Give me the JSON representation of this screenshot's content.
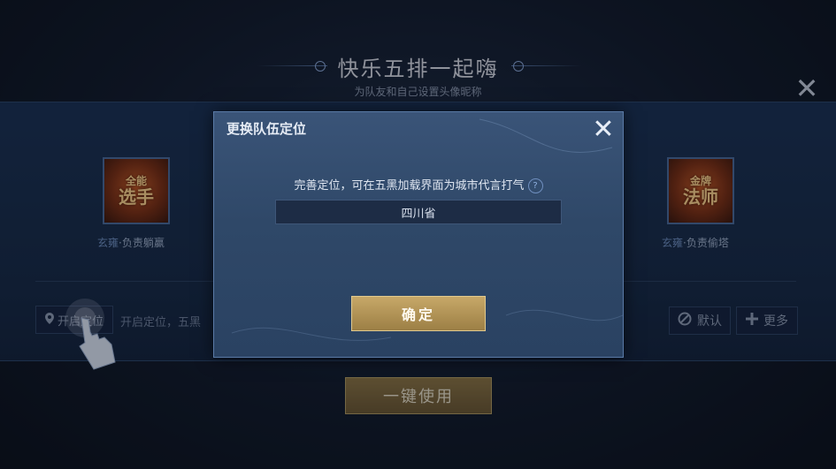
{
  "header": {
    "title": "快乐五排一起嗨",
    "subtitle": "为队友和自己设置头像昵称",
    "close_icon": "close-icon"
  },
  "roles": [
    {
      "badge_top": "全能",
      "badge_bottom": "选手",
      "name_prefix": "玄雍",
      "name_rest": "·负责躺赢"
    },
    {
      "badge_top": "金牌",
      "badge_bottom": "法师",
      "name_prefix": "玄雍",
      "name_rest": "·负责偷塔"
    }
  ],
  "location": {
    "button_label": "开启定位",
    "hint": "开启定位，五黑",
    "pin_icon": "location-pin-icon"
  },
  "side_buttons": {
    "default_label": "默认",
    "more_label": "更多"
  },
  "use_button": {
    "label": "一键使用"
  },
  "modal": {
    "title": "更换队伍定位",
    "message": "完善定位，可在五黑加载界面为城市代言打气",
    "help_icon": "?",
    "location_value": "四川省",
    "confirm_label": "确定"
  },
  "colors": {
    "gold": "#c7a868",
    "modal_bg": "#34506f",
    "accent_blue": "#6f8fbf"
  }
}
